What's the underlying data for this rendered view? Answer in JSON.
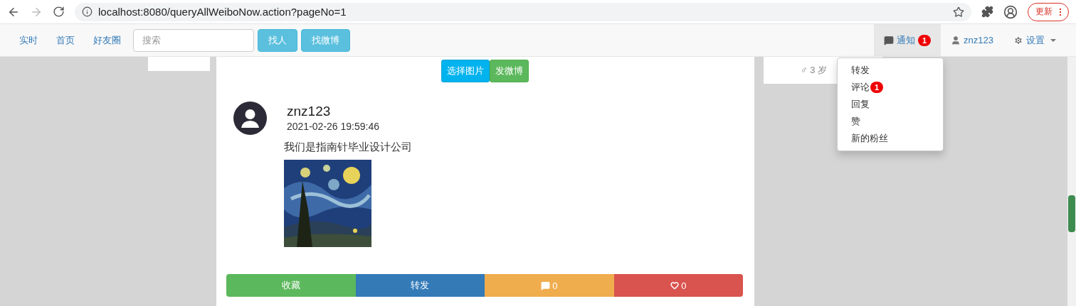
{
  "browser": {
    "back_enabled": true,
    "forward_enabled": false,
    "url": "localhost:8080/queryAllWeiboNow.action?pageNo=1",
    "update_button": "更新"
  },
  "navbar": {
    "links": [
      {
        "label": "实时"
      },
      {
        "label": "首页"
      },
      {
        "label": "好友圈"
      }
    ],
    "search": {
      "placeholder": "搜索"
    },
    "buttons": [
      "找人",
      "找微博"
    ],
    "notifications": {
      "label": "通知",
      "badge": "1",
      "open": true
    },
    "user": "znz123",
    "settings": "设置"
  },
  "notifications_menu": [
    {
      "label": "转发"
    },
    {
      "label": "评论",
      "badge": "1"
    },
    {
      "label": "回复"
    },
    {
      "label": "赞"
    },
    {
      "label": "新的粉丝"
    }
  ],
  "profile_card": {
    "info": "♂ 3 岁"
  },
  "composer": {
    "buttons": [
      {
        "kind": "pick",
        "label": "选择图片"
      },
      {
        "kind": "send",
        "label": "发微博"
      }
    ]
  },
  "post": {
    "author": "znz123",
    "time": "2021-02-26 19:59:46",
    "text": "我们是指南针毕业设计公司",
    "actions": [
      {
        "kind": "favorite",
        "label": "收藏"
      },
      {
        "kind": "repost",
        "label": "转发"
      },
      {
        "kind": "comment",
        "label": "0"
      },
      {
        "kind": "like",
        "label": "0"
      }
    ]
  }
}
